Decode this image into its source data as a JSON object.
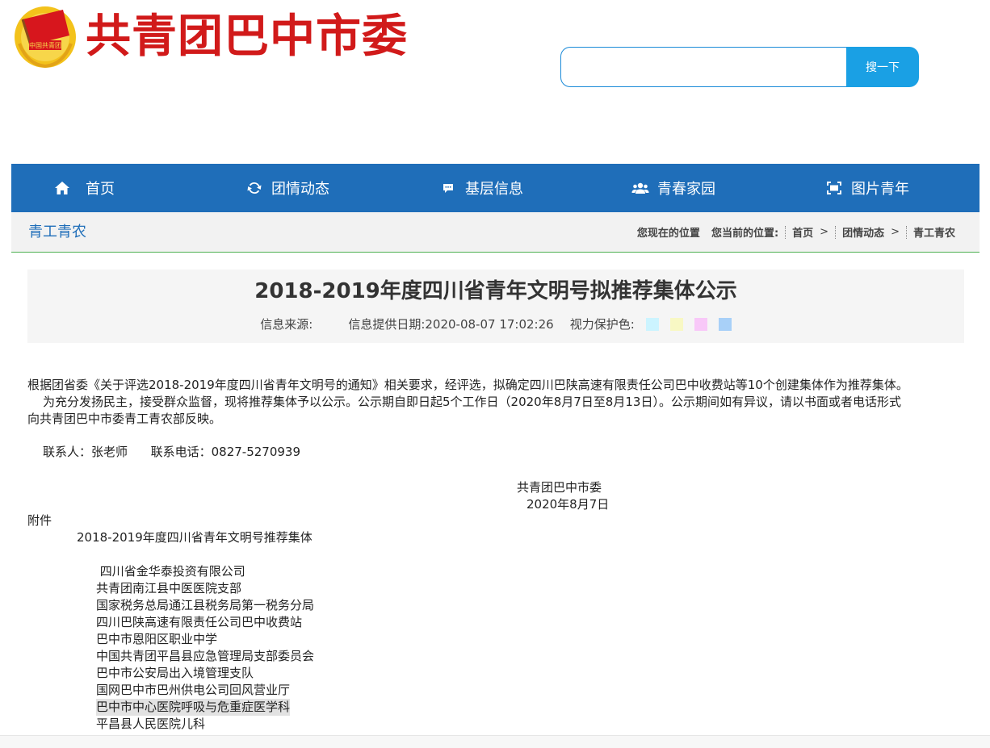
{
  "header": {
    "logo_text": "共青团巴中市委",
    "search_placeholder": "",
    "search_button": "搜一下"
  },
  "nav": [
    {
      "label": "首页",
      "icon": "home-icon"
    },
    {
      "label": "团情动态",
      "icon": "refresh-icon"
    },
    {
      "label": "基层信息",
      "icon": "chat-icon"
    },
    {
      "label": "青春家园",
      "icon": "users-icon"
    },
    {
      "label": "图片青年",
      "icon": "image-frame-icon"
    }
  ],
  "breadcrumb": {
    "section_title": "青工青农",
    "you_are_here": "您现在的位置",
    "current_label": "您当前的位置:",
    "items": [
      "首页",
      "团情动态",
      "青工青农"
    ],
    "separator": ">"
  },
  "article": {
    "title": "2018-2019年度四川省青年文明号拟推荐集体公示",
    "source_label": "信息来源:",
    "date_label": "信息提供日期:",
    "date_value": "2020-08-07 17:02:26",
    "eye_label": "视力保护色:",
    "eye_colors": [
      "#ccf4ff",
      "#f8f8c4",
      "#f8c8f8",
      "#a8d0f8"
    ],
    "para1": "根据团省委《关于评选2018-2019年度四川省青年文明号的通知》相关要求，经评选，拟确定四川巴陕高速有限责任公司巴中收费站等10个创建集体作为推荐集体。",
    "para2_line1": "为充分发扬民主，接受群众监督，现将推荐集体予以公示。公示期自即日起5个工作日（2020年8月7日至8月13日）。公示期间如有异议，请以书面或者电话形式",
    "para2_line2": "向共青团巴中市委青工青农部反映。",
    "contact": "联系人：张老师      联系电话：0827-5270939",
    "signature_org": "共青团巴中市委",
    "signature_date": "2020年8月7日",
    "attachment_label": "附件",
    "attachment_title": "2018-2019年度四川省青年文明号推荐集体",
    "list": [
      " 四川省金华泰投资有限公司",
      "共青团南江县中医医院支部",
      "国家税务总局通江县税务局第一税务分局",
      "四川巴陕高速有限责任公司巴中收费站",
      "巴中市恩阳区职业中学",
      "中国共青团平昌县应急管理局支部委员会",
      "巴中市公安局出入境管理支队",
      "国网巴中市巴州供电公司回风营业厅",
      "巴中市中心医院呼吸与危重症医学科",
      "平昌县人民医院儿科"
    ]
  }
}
